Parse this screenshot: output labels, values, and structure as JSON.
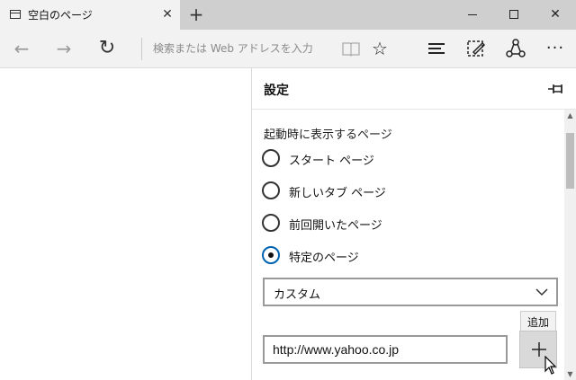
{
  "tab": {
    "title": "空白のページ",
    "close_glyph": "✕",
    "new_tab_glyph": "+"
  },
  "window_controls": {
    "close_glyph": "✕"
  },
  "navbar": {
    "back_glyph": "←",
    "forward_glyph": "→",
    "refresh_glyph": "↻",
    "address_placeholder": "検索または Web アドレスを入力",
    "reading_view_glyph": "📖",
    "favorite_glyph": "☆",
    "more_glyph": "···"
  },
  "icons": {
    "back": "back-arrow-icon",
    "forward": "forward-arrow-icon",
    "refresh": "refresh-icon",
    "reading_view": "book-icon",
    "favorite": "star-icon",
    "hub": "hub-icon",
    "note": "pen-note-icon",
    "share": "share-icon",
    "more": "ellipsis-icon",
    "pin": "pin-icon",
    "add": "plus-icon"
  },
  "settings": {
    "title": "設定",
    "startup_label": "起動時に表示するページ",
    "options": [
      {
        "label": "スタート ページ",
        "selected": false
      },
      {
        "label": "新しいタブ ページ",
        "selected": false
      },
      {
        "label": "前回開いたページ",
        "selected": false
      },
      {
        "label": "特定のページ",
        "selected": true
      }
    ],
    "page_select_value": "カスタム",
    "add_tooltip": "追加",
    "url_value": "http://www.yahoo.co.jp"
  },
  "colors": {
    "accent": "#0063b1",
    "tab_bar": "#cfcfcf",
    "chrome": "#f2f2f2"
  }
}
